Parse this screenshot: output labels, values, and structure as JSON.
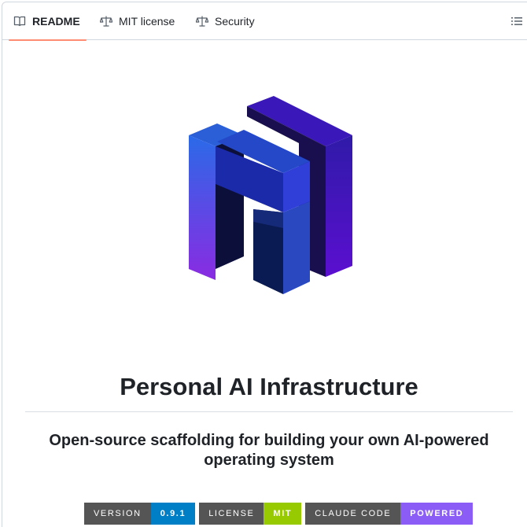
{
  "tabs": [
    {
      "label": "README",
      "icon": "book-icon",
      "active": true
    },
    {
      "label": "MIT license",
      "icon": "scale-icon",
      "active": false
    },
    {
      "label": "Security",
      "icon": "scale-icon",
      "active": false
    }
  ],
  "toolbar": {
    "toc_icon": "list-icon"
  },
  "readme": {
    "logo_icon": "pai-cube-logo",
    "title": "Personal AI Infrastructure",
    "subtitle": "Open-source scaffolding for building your own AI-powered operating system",
    "badges": [
      {
        "label": "VERSION",
        "value": "0.9.1",
        "color": "#007ec6"
      },
      {
        "label": "LICENSE",
        "value": "MIT",
        "color": "#97ca00"
      },
      {
        "label": "CLAUDE CODE",
        "value": "POWERED",
        "color": "#8b5cf6"
      }
    ]
  },
  "colors": {
    "tab_underline": "#fd8c73",
    "border": "#d0d7de",
    "text": "#1f2328"
  }
}
